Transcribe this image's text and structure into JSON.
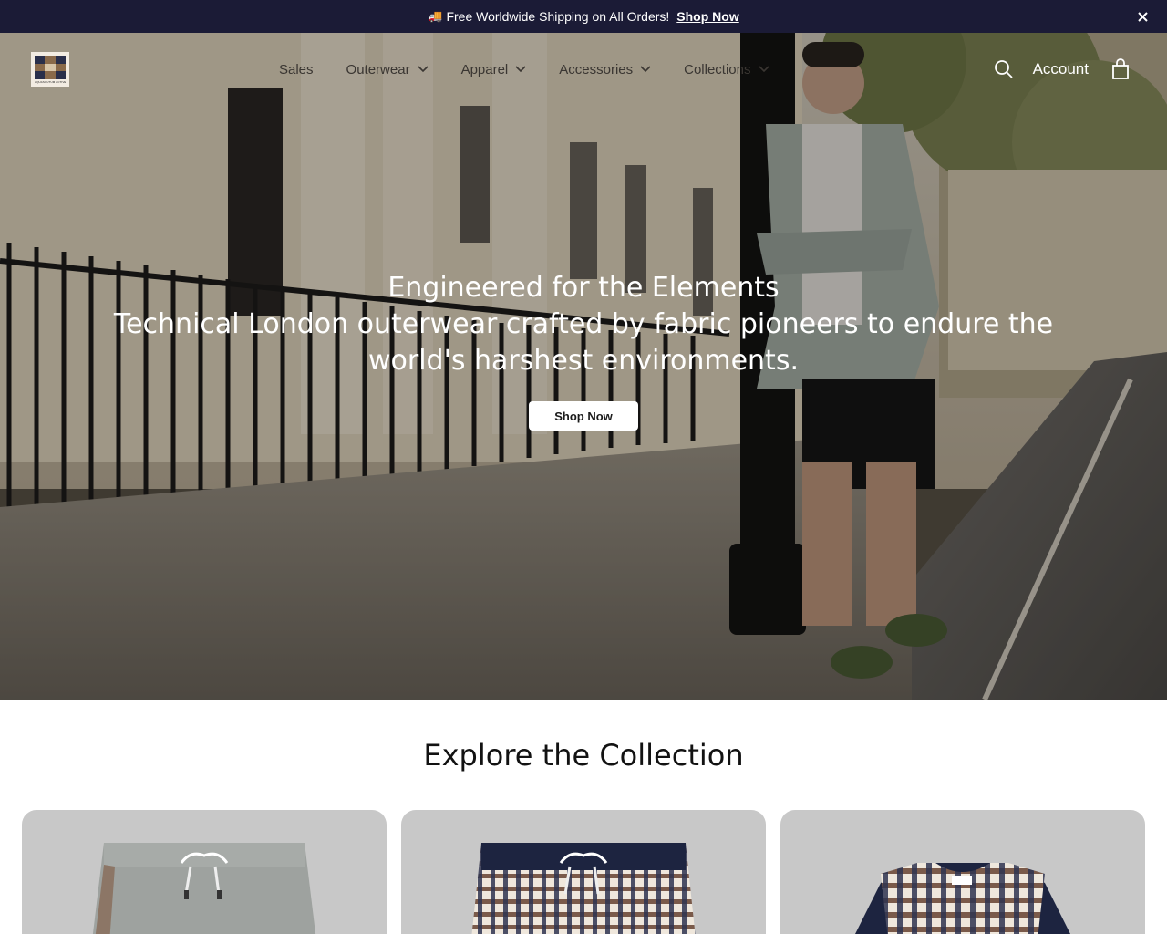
{
  "announcement": {
    "emoji": "🚚",
    "message": "Free Worldwide Shipping on All Orders!",
    "link_label": "Shop Now",
    "close_label": "✕"
  },
  "header": {
    "logo_text": "AQUASCUTUM ACTIVE",
    "nav": [
      {
        "label": "Sales",
        "has_dropdown": false
      },
      {
        "label": "Outerwear",
        "has_dropdown": true
      },
      {
        "label": "Apparel",
        "has_dropdown": true
      },
      {
        "label": "Accessories",
        "has_dropdown": true
      },
      {
        "label": "Collections",
        "has_dropdown": true
      }
    ],
    "account_label": "Account",
    "icons": [
      "search-icon",
      "bag-icon"
    ]
  },
  "hero": {
    "title": "Engineered for the Elements",
    "subtitle": "Technical London outerwear crafted by fabric pioneers to endure the world's harshest environments.",
    "button_label": "Shop Now"
  },
  "collection": {
    "title": "Explore the Collection",
    "cards": [
      {
        "product": "grey swim shorts"
      },
      {
        "product": "check swim shorts"
      },
      {
        "product": "check panel t-shirt"
      }
    ]
  },
  "colors": {
    "announcement_bg": "#1b1b36",
    "card_bg": "#c8c8c8",
    "text_dark": "#121212"
  }
}
